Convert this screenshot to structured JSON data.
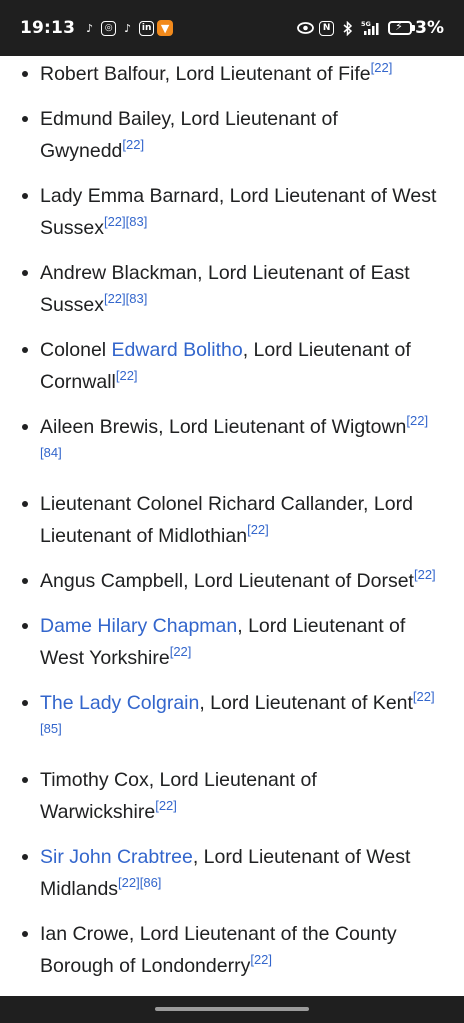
{
  "status_bar": {
    "time": "19:13",
    "left_icons": [
      "tiktok-icon",
      "instagram-icon",
      "tiktok-icon",
      "linkedin-icon",
      "brave-icon"
    ],
    "right_icons": [
      "eye-icon",
      "nfc-icon",
      "bluetooth-icon",
      "signal-5g-icon",
      "battery-charging-icon"
    ],
    "network": "5G",
    "battery_percent": "3%"
  },
  "list": [
    {
      "parts": [
        {
          "text": "Robert Balfour, Lord Lieutenant of Fife",
          "link": false
        }
      ],
      "refs": [
        "[22]"
      ]
    },
    {
      "parts": [
        {
          "text": "Edmund Bailey, Lord Lieutenant of Gwynedd",
          "link": false
        }
      ],
      "refs": [
        "[22]"
      ]
    },
    {
      "parts": [
        {
          "text": "Lady Emma Barnard, Lord Lieutenant of West Sussex",
          "link": false
        }
      ],
      "refs": [
        "[22]",
        "[83]"
      ]
    },
    {
      "parts": [
        {
          "text": "Andrew Blackman, Lord Lieutenant of East Sussex",
          "link": false
        }
      ],
      "refs": [
        "[22]",
        "[83]"
      ]
    },
    {
      "parts": [
        {
          "text": "Colonel ",
          "link": false
        },
        {
          "text": "Edward Bolitho",
          "link": true
        },
        {
          "text": ", Lord Lieutenant of Cornwall",
          "link": false
        }
      ],
      "refs": [
        "[22]"
      ]
    },
    {
      "parts": [
        {
          "text": "Aileen Brewis, Lord Lieutenant of Wigtown",
          "link": false
        }
      ],
      "refs": [
        "[22]",
        "[84]"
      ]
    },
    {
      "parts": [
        {
          "text": "Lieutenant Colonel Richard Callander, Lord Lieutenant of Midlothian",
          "link": false
        }
      ],
      "refs": [
        "[22]"
      ]
    },
    {
      "parts": [
        {
          "text": "Angus Campbell, Lord Lieutenant of Dorset",
          "link": false
        }
      ],
      "refs": [
        "[22]"
      ]
    },
    {
      "parts": [
        {
          "text": "Dame Hilary Chapman",
          "link": true
        },
        {
          "text": ", Lord Lieutenant of West Yorkshire",
          "link": false
        }
      ],
      "refs": [
        "[22]"
      ]
    },
    {
      "parts": [
        {
          "text": "The Lady Colgrain",
          "link": true
        },
        {
          "text": ", Lord Lieutenant of Kent",
          "link": false
        }
      ],
      "refs": [
        "[22]",
        "[85]"
      ]
    },
    {
      "parts": [
        {
          "text": "Timothy Cox, Lord Lieutenant of Warwickshire",
          "link": false
        }
      ],
      "refs": [
        "[22]"
      ]
    },
    {
      "parts": [
        {
          "text": "Sir John Crabtree",
          "link": true
        },
        {
          "text": ", Lord Lieutenant of West Midlands",
          "link": false
        }
      ],
      "refs": [
        "[22]",
        "[86]"
      ]
    },
    {
      "parts": [
        {
          "text": "Ian Crowe, Lord Lieutenant of the County Borough of Londonderry",
          "link": false
        }
      ],
      "refs": [
        "[22]"
      ]
    }
  ],
  "colors": {
    "text": "#202122",
    "link": "#3366cc",
    "status_bar_bg": "#1f1f1f",
    "nav_bar_bg": "#1f1f1f"
  }
}
